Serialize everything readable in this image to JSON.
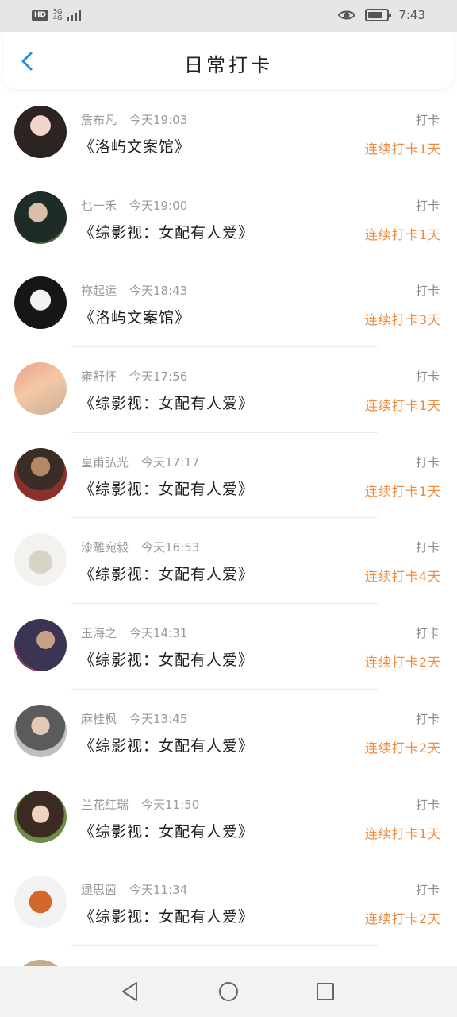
{
  "status_bar": {
    "hd": "HD",
    "network": "5G",
    "network_sub": "4G",
    "time": "7:43",
    "battery_level": 0.8
  },
  "header": {
    "title": "日常打卡",
    "back_icon": "chevron-left-icon"
  },
  "colors": {
    "accent": "#2a8ee0",
    "streak": "#f08a3c",
    "meta": "#9a9a9a"
  },
  "rows": [
    {
      "name": "詹布凡",
      "time": "今天19:03",
      "book": "《洛屿文案馆》",
      "checkin": "打卡",
      "streak": "连续打卡1天"
    },
    {
      "name": "乜一禾",
      "time": "今天19:00",
      "book": "《综影视：女配有人爱》",
      "checkin": "打卡",
      "streak": "连续打卡1天"
    },
    {
      "name": "祢起运",
      "time": "今天18:43",
      "book": "《洛屿文案馆》",
      "checkin": "打卡",
      "streak": "连续打卡3天"
    },
    {
      "name": "雍舒怀",
      "time": "今天17:56",
      "book": "《综影视：女配有人爱》",
      "checkin": "打卡",
      "streak": "连续打卡1天"
    },
    {
      "name": "皇甫弘光",
      "time": "今天17:17",
      "book": "《综影视：女配有人爱》",
      "checkin": "打卡",
      "streak": "连续打卡1天"
    },
    {
      "name": "漆雕宛毅",
      "time": "今天16:53",
      "book": "《综影视：女配有人爱》",
      "checkin": "打卡",
      "streak": "连续打卡4天"
    },
    {
      "name": "玉海之",
      "time": "今天14:31",
      "book": "《综影视：女配有人爱》",
      "checkin": "打卡",
      "streak": "连续打卡2天"
    },
    {
      "name": "麻桂枫",
      "time": "今天13:45",
      "book": "《综影视：女配有人爱》",
      "checkin": "打卡",
      "streak": "连续打卡2天"
    },
    {
      "name": "兰花红瑞",
      "time": "今天11:50",
      "book": "《综影视：女配有人爱》",
      "checkin": "打卡",
      "streak": "连续打卡1天"
    },
    {
      "name": "逯思茵",
      "time": "今天11:34",
      "book": "《综影视：女配有人爱》",
      "checkin": "打卡",
      "streak": "连续打卡2天"
    }
  ],
  "nav": {
    "back": "triangle-back-icon",
    "home": "circle-home-icon",
    "recents": "square-recents-icon"
  }
}
